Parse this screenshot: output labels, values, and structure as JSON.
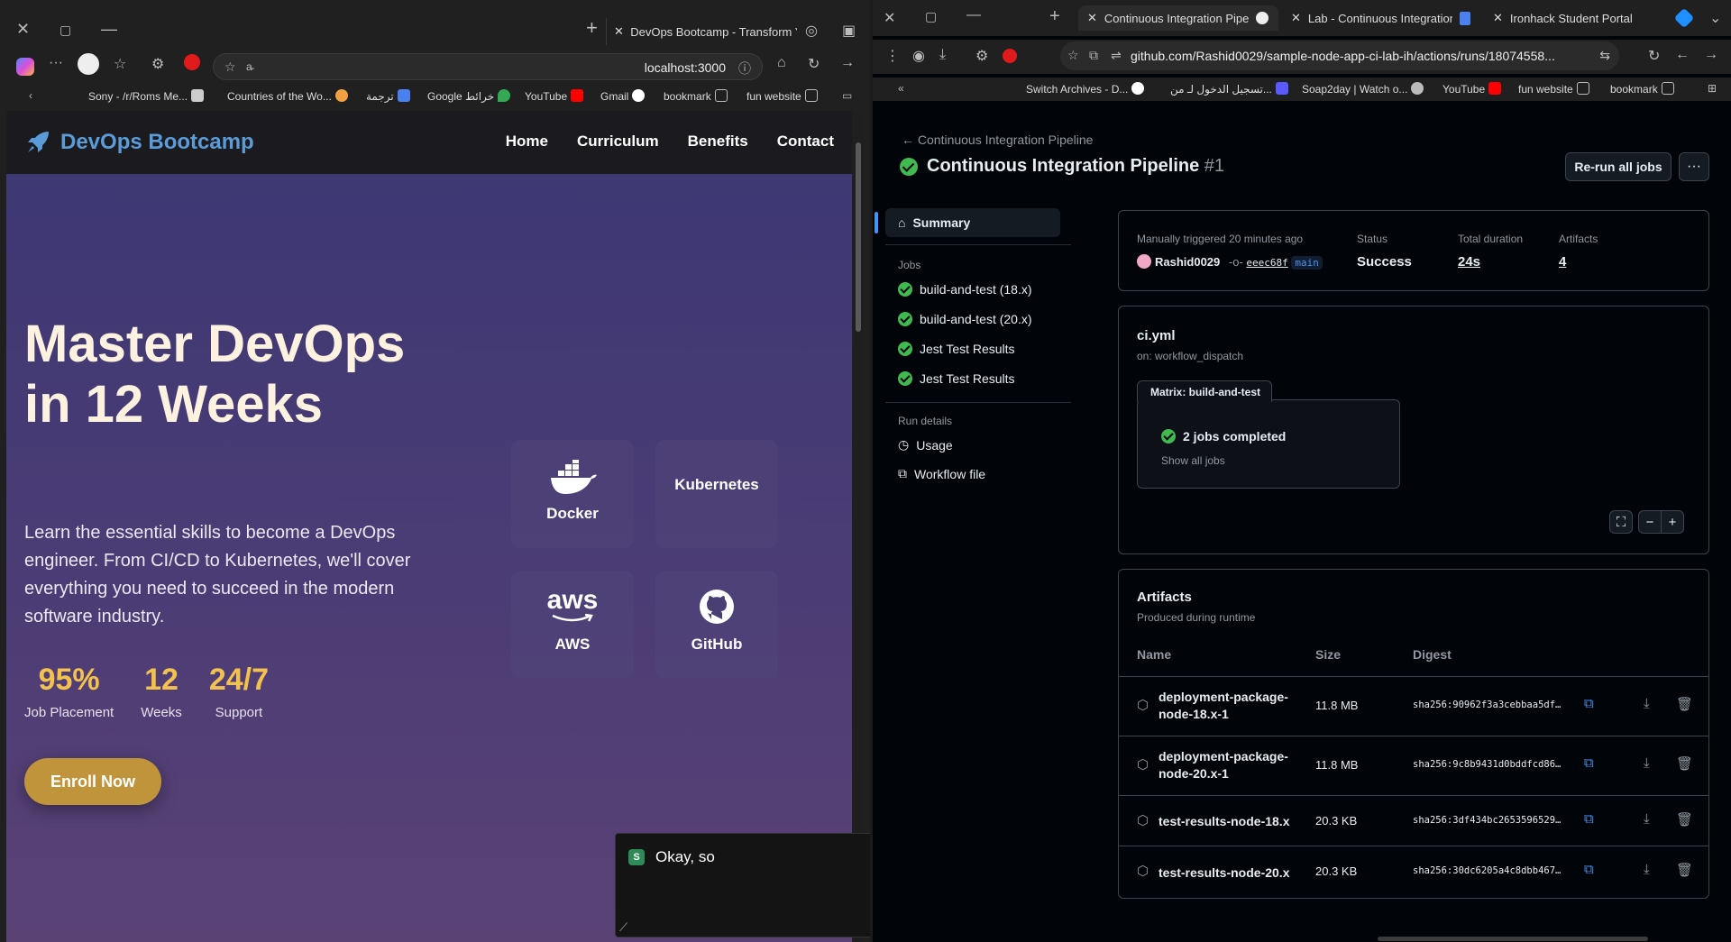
{
  "left_browser": {
    "tab_title": "DevOps Bootcamp - Transform Yo",
    "url": "localhost:3000",
    "address_hint": "a̵̵",
    "bookmarks": [
      "Sony - /r/Roms Me...",
      "Countries of the Wo...",
      "ترجمة",
      "Google خرائط",
      "YouTube",
      "Gmail",
      "bookmark",
      "fun website"
    ]
  },
  "site": {
    "brand": "DevOps Bootcamp",
    "nav": [
      "Home",
      "Curriculum",
      "Benefits",
      "Contact"
    ],
    "hero_title": "Master DevOps in 12 Weeks",
    "hero_sub": "Learn the essential skills to become a DevOps engineer. From CI/CD to Kubernetes, we'll cover everything you need to succeed in the modern software industry.",
    "stats": [
      {
        "num": "95%",
        "label": "Job Placement"
      },
      {
        "num": "12",
        "label": "Weeks"
      },
      {
        "num": "24/7",
        "label": "Support"
      }
    ],
    "enroll": "Enroll Now",
    "tech": [
      "Docker",
      "Kubernetes",
      "AWS",
      "GitHub"
    ],
    "aws_logo_text": "aws"
  },
  "chat": {
    "avatar": "S",
    "message": "Okay, so"
  },
  "right_browser": {
    "tabs": [
      "Continuous Integration Pipelin",
      "Lab - Continuous Integration (",
      "Ironhack Student Portal"
    ],
    "url": "github.com/Rashid0029/sample-node-app-ci-lab-ih/actions/runs/18074558...",
    "bookmarks": [
      "Switch Archives - D...",
      "تسجيل الدخول لـ من...",
      "Soap2day | Watch o...",
      "YouTube",
      "fun website",
      "bookmark"
    ]
  },
  "github": {
    "back_link": "Continuous Integration Pipeline",
    "run_title": "Continuous Integration Pipeline",
    "run_number": "#1",
    "rerun": "Re-run all jobs",
    "sidenav": {
      "summary": "Summary",
      "jobs_heading": "Jobs",
      "jobs": [
        "build-and-test (18.x)",
        "build-and-test (20.x)",
        "Jest Test Results",
        "Jest Test Results"
      ],
      "run_details_heading": "Run details",
      "usage": "Usage",
      "workflow_file": "Workflow file"
    },
    "summary": {
      "trigger": "Manually triggered 20 minutes ago",
      "actor": "Rashid0029",
      "sha": "eeec68f",
      "branch": "main",
      "status_label": "Status",
      "status": "Success",
      "duration_label": "Total duration",
      "duration": "24s",
      "artifacts_label": "Artifacts",
      "artifacts_count": "4"
    },
    "workflow": {
      "file": "ci.yml",
      "trigger": "on: workflow_dispatch",
      "matrix_label": "Matrix: build-and-test",
      "jobs_completed": "2 jobs completed",
      "show_all": "Show all jobs"
    },
    "artifacts": {
      "title": "Artifacts",
      "subtitle": "Produced during runtime",
      "columns": [
        "Name",
        "Size",
        "Digest"
      ],
      "rows": [
        {
          "name": "deployment-package-node-18.x-1",
          "size": "11.8 MB",
          "digest": "sha256:90962f3a3cebbaa5df…"
        },
        {
          "name": "deployment-package-node-20.x-1",
          "size": "11.8 MB",
          "digest": "sha256:9c8b9431d0bddfcd86…"
        },
        {
          "name": "test-results-node-18.x",
          "size": "20.3 KB",
          "digest": "sha256:3df434bc2653596529…"
        },
        {
          "name": "test-results-node-20.x",
          "size": "20.3 KB",
          "digest": "sha256:30dc6205a4c8dbb467…"
        }
      ]
    }
  },
  "colors": {
    "success": "#3fb950",
    "accent": "#4493f8",
    "enroll": "#c0943a",
    "stat": "#f2c14e",
    "brand": "#5a9bd8"
  }
}
